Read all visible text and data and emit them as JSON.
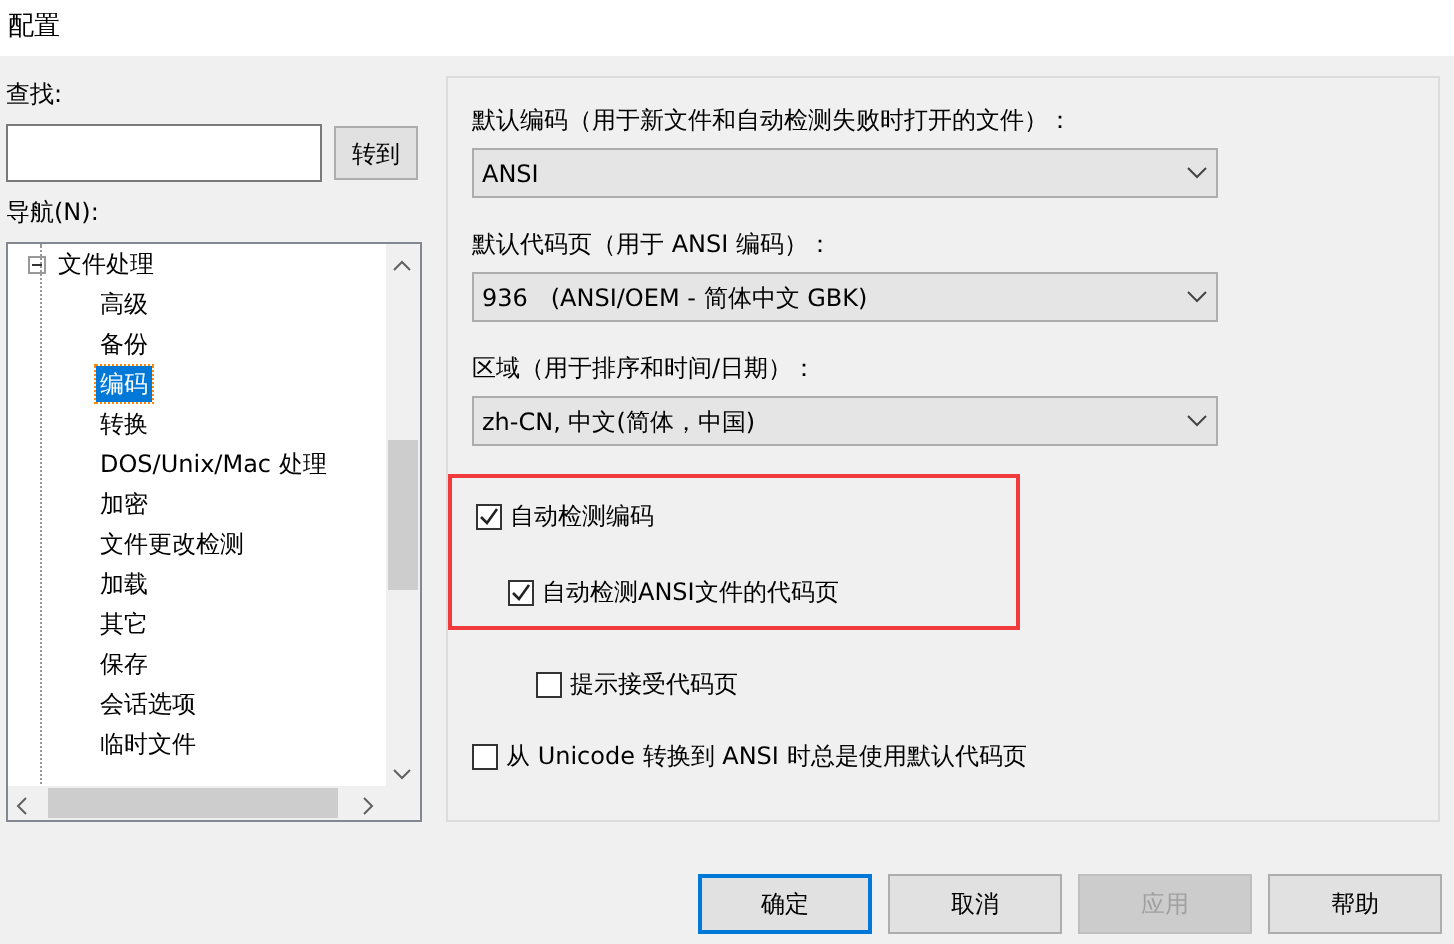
{
  "window": {
    "title": "配置"
  },
  "search": {
    "label": "查找:",
    "button": "转到"
  },
  "navigation": {
    "label": "导航(N):",
    "tree": [
      {
        "label": "文件处理",
        "expanded": true,
        "selected": false,
        "children": [
          {
            "label": "高级",
            "selected": false
          },
          {
            "label": "备份",
            "selected": false
          },
          {
            "label": "编码",
            "selected": true
          },
          {
            "label": "转换",
            "selected": false
          },
          {
            "label": "DOS/Unix/Mac 处理",
            "selected": false
          },
          {
            "label": "加密",
            "selected": false
          },
          {
            "label": "文件更改检测",
            "selected": false
          },
          {
            "label": "加载",
            "selected": false
          },
          {
            "label": "其它",
            "selected": false
          },
          {
            "label": "保存",
            "selected": false
          },
          {
            "label": "会话选项",
            "selected": false
          },
          {
            "label": "临时文件",
            "selected": false
          }
        ]
      }
    ]
  },
  "fields": [
    {
      "label": "默认编码（用于新文件和自动检测失败时打开的文件）：",
      "value": "ANSI"
    },
    {
      "label": "默认代码页（用于 ANSI 编码）：",
      "value": "936   (ANSI/OEM - 简体中文 GBK)"
    },
    {
      "label": "区域（用于排序和时间/日期）：",
      "value": "zh-CN, 中文(简体，中国)"
    }
  ],
  "annotation": {
    "kind": "frame"
  },
  "checkboxes": [
    {
      "label": "自动检测编码",
      "checked": true,
      "children": [
        {
          "label": "自动检测ANSI文件的代码页",
          "checked": true,
          "children": [
            {
              "label": "提示接受代码页",
              "checked": false
            }
          ]
        }
      ]
    },
    {
      "label": "从 Unicode 转换到 ANSI 时总是使用默认代码页",
      "checked": false
    }
  ],
  "buttons": [
    {
      "label": "确定",
      "default": true,
      "disabled": false
    },
    {
      "label": "取消",
      "default": false,
      "disabled": false
    },
    {
      "label": "应用",
      "default": false,
      "disabled": true
    },
    {
      "label": "帮助",
      "default": false,
      "disabled": false
    }
  ]
}
